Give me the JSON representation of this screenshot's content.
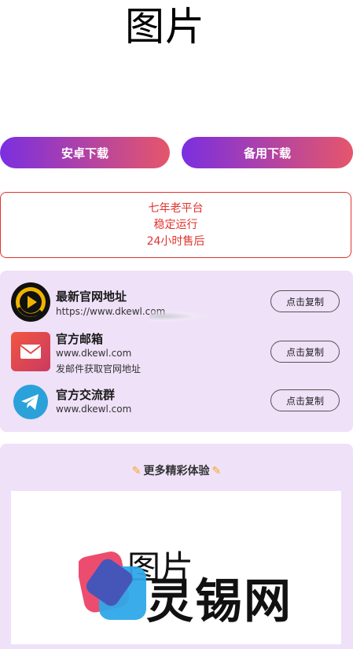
{
  "hero": {
    "title": "图片"
  },
  "buttons": {
    "android": "安卓下载",
    "backup": "备用下载"
  },
  "notice": {
    "lines": [
      "七年老平台",
      "稳定运行",
      "24小时售后"
    ]
  },
  "contacts": [
    {
      "title": "最新官网地址",
      "sub": "https://www.dkewl.com",
      "action": "点击复制",
      "icon": "play-logo-icon"
    },
    {
      "title": "官方邮箱",
      "sub": "www.dkewl.com",
      "sub2": "发邮件获取官网地址",
      "action": "点击复制",
      "icon": "mail-icon"
    },
    {
      "title": "官方交流群",
      "sub": "www.dkewl.com",
      "action": "点击复制",
      "icon": "telegram-icon"
    }
  ],
  "more": {
    "title": "更多精彩体验",
    "banner_back_text": "图片",
    "banner_front_text": "灵锡网",
    "banner_icon": "brand-logo-icon"
  },
  "colors": {
    "gradient_start": "#7b2fe0",
    "gradient_end": "#e5566b",
    "notice_red": "#e0342f",
    "card_bg": "#efe1f8"
  }
}
